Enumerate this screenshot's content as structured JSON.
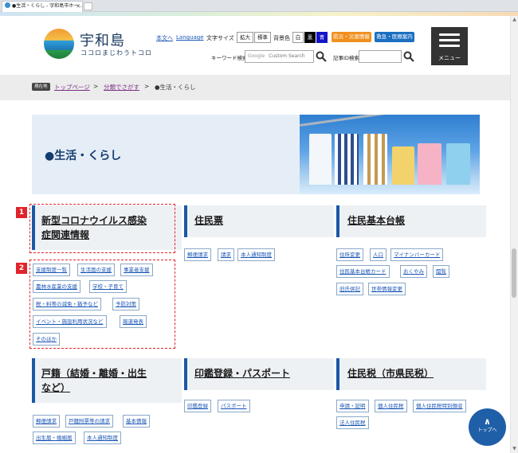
{
  "browser": {
    "tab_title": "●生活・くらし - 宇和島市ホー..."
  },
  "header": {
    "logo_title": "宇和島",
    "logo_sub": "ココロまじわうトコロ",
    "honbun": "本文へ",
    "language": "Language",
    "font_size_label": "文字サイズ",
    "font_large": "拡大",
    "font_standard": "標準",
    "bg_label": "背景色",
    "bg_white": "白",
    "bg_black": "黒",
    "bg_blue": "青",
    "disaster_btn": "防災・災害情報",
    "emergency_btn": "救急・医療案内",
    "keyword_label": "キーワード検索",
    "keyword_placeholder": "Custom Search",
    "google_text": "Google",
    "article_id_label": "記事ID検索",
    "menu_label": "メニュー",
    "colors": {
      "disaster": "#f0901e",
      "emergency": "#1c6fc0",
      "menu": "#333333"
    }
  },
  "breadcrumb": {
    "tag": "現在地",
    "items": [
      "トップページ",
      "分類でさがす",
      "●生活・くらし"
    ],
    "separator": ">"
  },
  "banner": {
    "title": "●生活・くらし"
  },
  "annotations": {
    "one": "1",
    "two": "2"
  },
  "categories": [
    {
      "title_line1": "新型コロナウイルス感染",
      "title_line2": "症関連情報",
      "tags": [
        "支援制度一覧",
        "生活面の支援",
        "事業者支援",
        "農林水産業の支援",
        "学校・子育て",
        "税・料等の減免・猶予など",
        "予防対策",
        "イベント・施設利用状況など",
        "報道発表",
        "そのほか"
      ]
    },
    {
      "title_line1": "住民票",
      "title_line2": "",
      "tags": [
        "郵便請求",
        "請求",
        "本人通知制度"
      ]
    },
    {
      "title_line1": "住民基本台帳",
      "title_line2": "",
      "tags": [
        "住所変更",
        "人口",
        "マイナンバーカード",
        "住民基本台帳カード",
        "おくやみ",
        "閲覧",
        "旧氏併記",
        "世帯情報変更"
      ]
    },
    {
      "title_line1": "戸籍（結婚・離婚・出生",
      "title_line2": "など）",
      "tags": [
        "郵便請求",
        "戸籍附票等の請求",
        "基本情報",
        "出生届・婚姻届",
        "本人通知制度"
      ]
    },
    {
      "title_line1": "印鑑登録・パスポート",
      "title_line2": "",
      "tags": [
        "印鑑登録",
        "パスポート"
      ]
    },
    {
      "title_line1": "住民税（市県民税）",
      "title_line2": "",
      "tags": [
        "申請・証明",
        "個人住民税",
        "個人住民税特別徴収",
        "法人住民税"
      ]
    }
  ],
  "totop": {
    "arrow": "∧",
    "label": "トップへ"
  }
}
